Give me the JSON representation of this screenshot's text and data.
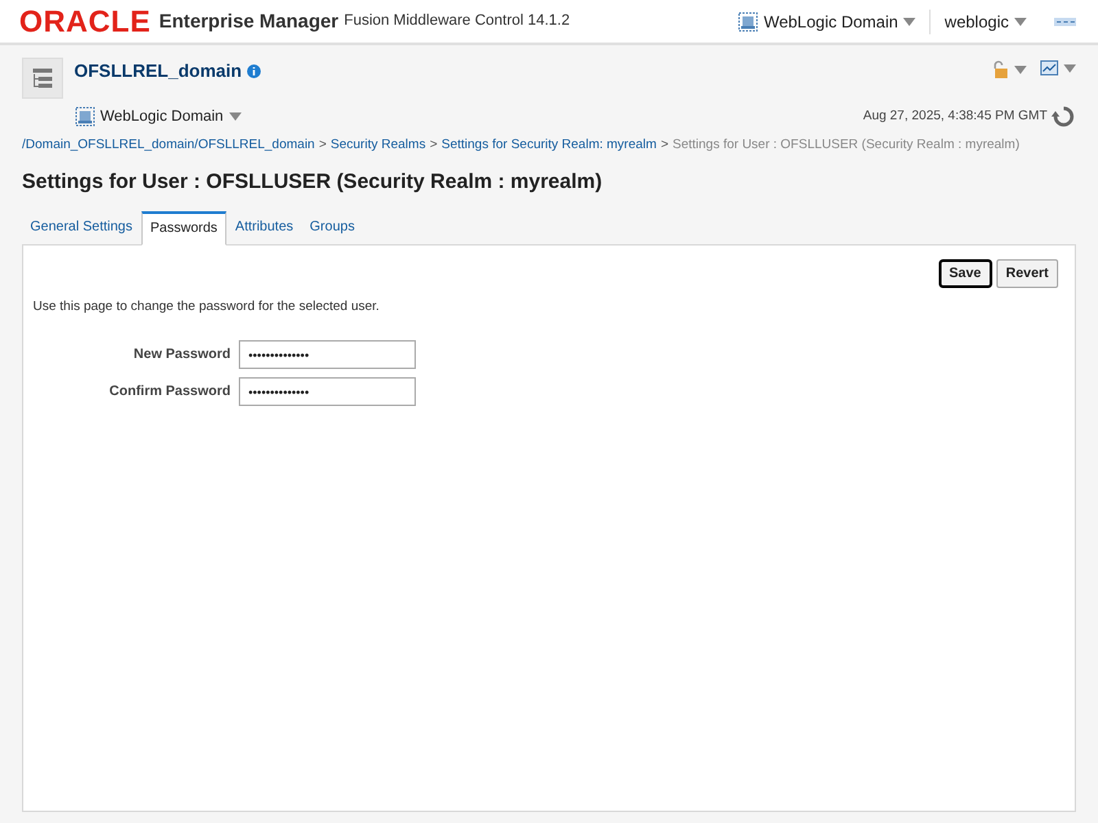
{
  "header": {
    "logo": "ORACLE",
    "product": "Enterprise Manager",
    "subtitle": "Fusion Middleware Control 14.1.2",
    "target_menu": "WebLogic Domain",
    "user_menu": "weblogic"
  },
  "target": {
    "name": "OFSLLREL_domain",
    "type_menu": "WebLogic Domain",
    "timestamp": "Aug 27, 2025, 4:38:45 PM GMT"
  },
  "breadcrumb": [
    {
      "kind": "link",
      "text": "/Domain_OFSLLREL_domain/OFSLLREL_domain"
    },
    {
      "kind": "separator",
      "text": ">"
    },
    {
      "kind": "link",
      "text": "Security Realms"
    },
    {
      "kind": "separator",
      "text": ">"
    },
    {
      "kind": "link",
      "text": "Settings for Security Realm: myrealm"
    },
    {
      "kind": "separator",
      "text": ">"
    },
    {
      "kind": "current",
      "text": "Settings for User : OFSLLUSER (Security Realm : myrealm)"
    }
  ],
  "page_title": "Settings for User : OFSLLUSER (Security Realm : myrealm)",
  "tabs": [
    {
      "label": "General Settings",
      "selected": false
    },
    {
      "label": "Passwords",
      "selected": true
    },
    {
      "label": "Attributes",
      "selected": false
    },
    {
      "label": "Groups",
      "selected": false
    }
  ],
  "buttons": [
    {
      "label": "Save",
      "selected": true
    },
    {
      "label": "Revert",
      "selected": false
    }
  ],
  "description": "Use this page to change the password for the selected user.",
  "fields": [
    {
      "label": "New Password",
      "value": "••••••••••••••"
    },
    {
      "label": "Confirm Password",
      "value": "••••••••••••••"
    }
  ]
}
